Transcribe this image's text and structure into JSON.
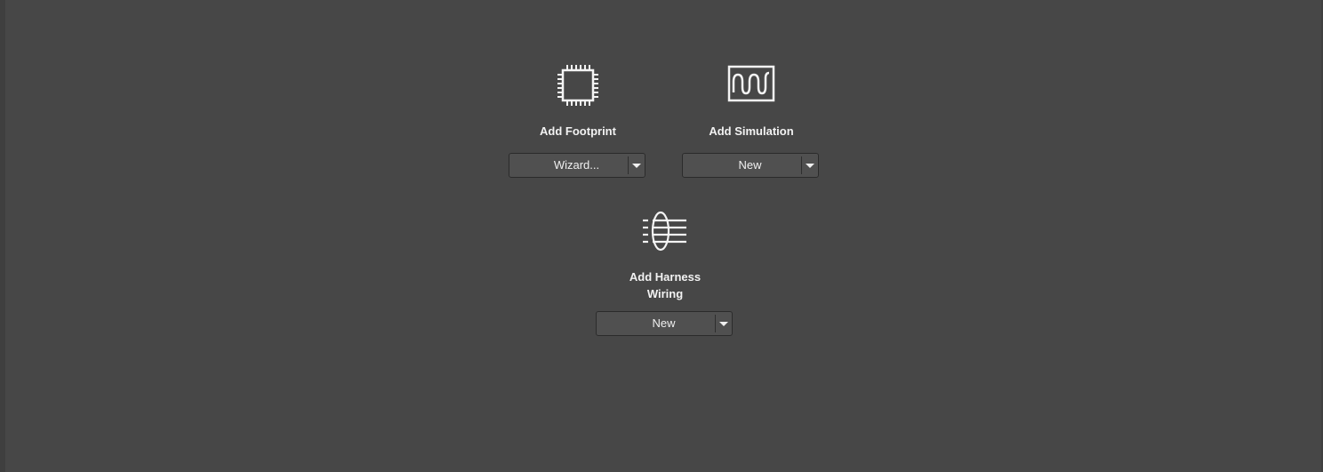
{
  "actions": [
    {
      "title": "Add Footprint",
      "icon": "chip-icon",
      "button_label": "Wizard...",
      "dropdown_icon": "chevron-down-icon"
    },
    {
      "title": "Add Simulation",
      "icon": "waveform-icon",
      "button_label": "New",
      "dropdown_icon": "chevron-down-icon"
    },
    {
      "title_line1": "Add Harness",
      "title_line2": "Wiring",
      "icon": "harness-wiring-icon",
      "button_label": "New",
      "dropdown_icon": "chevron-down-icon"
    }
  ],
  "colors": {
    "background": "#474747",
    "text": "#f2f2f2",
    "button": "#505050",
    "border": "#2b2b2b"
  }
}
